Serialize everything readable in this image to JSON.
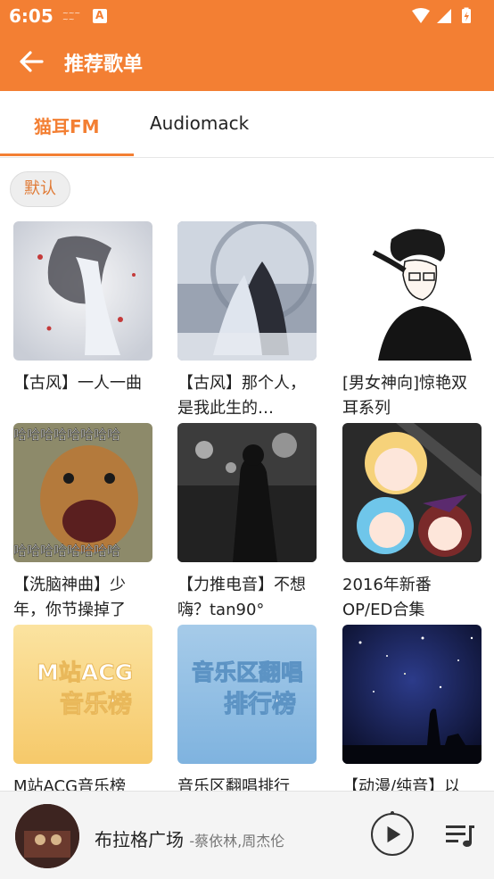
{
  "status_bar": {
    "time": "6:05"
  },
  "app_bar": {
    "title": "推荐歌单"
  },
  "tabs": [
    {
      "label": "猫耳FM",
      "selected": true
    },
    {
      "label": "Audiomack",
      "selected": false
    }
  ],
  "filter_chip": {
    "label": "默认"
  },
  "playlists": [
    {
      "title": "【古风】一人一曲"
    },
    {
      "title": "【古风】那个人，是我此生的…"
    },
    {
      "title": "[男女神向]惊艳双耳系列"
    },
    {
      "title": "【洗脑神曲】少年，你节操掉了"
    },
    {
      "title": "【力推电音】不想嗨？tan90°"
    },
    {
      "title": "2016年新番OP/ED合集"
    },
    {
      "title": "M站ACG音乐榜"
    },
    {
      "title": "音乐区翻唱排行"
    },
    {
      "title": "【动漫/纯音】以"
    }
  ],
  "covers": {
    "meme_text": "哈哈哈哈哈哈哈哈",
    "m_acg_line1": "M站ACG",
    "m_acg_line2": "音乐榜",
    "cover_line1": "音乐区翻唱",
    "cover_line2": "排行榜"
  },
  "now_playing": {
    "song": "布拉格广场",
    "artist": "-蔡依林,周杰伦"
  },
  "colors": {
    "accent": "#f37f33"
  }
}
